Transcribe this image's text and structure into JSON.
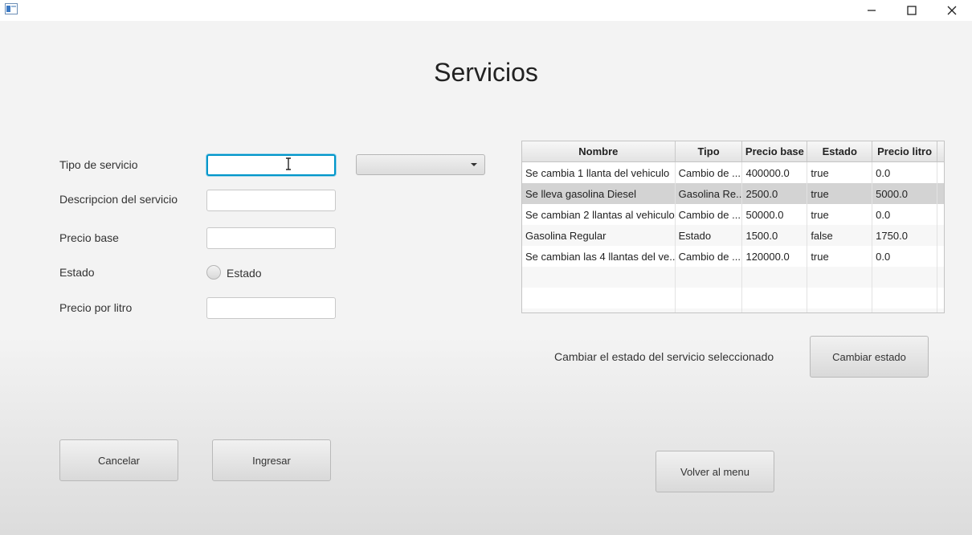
{
  "window": {
    "icons": {
      "app": "app-window-icon",
      "minimize": "minimize-icon",
      "maximize": "maximize-icon",
      "close": "close-icon"
    }
  },
  "page": {
    "title": "Servicios"
  },
  "form": {
    "tipo_label": "Tipo de servicio",
    "tipo_value": "",
    "tipo_combo_value": "",
    "descripcion_label": "Descripcion del servicio",
    "descripcion_value": "",
    "precio_base_label": "Precio base",
    "precio_base_value": "",
    "estado_label": "Estado",
    "estado_radio_label": "Estado",
    "estado_checked": false,
    "precio_litro_label": "Precio por litro",
    "precio_litro_value": ""
  },
  "table": {
    "columns": [
      "Nombre",
      "Tipo",
      "Precio base",
      "Estado",
      "Precio litro"
    ],
    "rows": [
      [
        "Se cambia 1 llanta del vehiculo",
        "Cambio de ...",
        "400000.0",
        "true",
        "0.0"
      ],
      [
        "Se lleva gasolina Diesel",
        "Gasolina Re...",
        "2500.0",
        "true",
        "5000.0"
      ],
      [
        "Se cambian 2 llantas al vehiculo",
        "Cambio de ...",
        "50000.0",
        "true",
        "0.0"
      ],
      [
        "Gasolina Regular",
        "Estado",
        "1500.0",
        "false",
        "1750.0"
      ],
      [
        "Se cambian las 4 llantas del ve...",
        "Cambio de ...",
        "120000.0",
        "true",
        "0.0"
      ]
    ],
    "selected_row_index": 1
  },
  "actions": {
    "cambiar_hint": "Cambiar el estado del servicio seleccionado",
    "cambiar_label": "Cambiar estado",
    "cancelar_label": "Cancelar",
    "ingresar_label": "Ingresar",
    "volver_label": "Volver al menu"
  },
  "colors": {
    "focus": "#0096c9",
    "selected_row": "#d3d3d3"
  }
}
